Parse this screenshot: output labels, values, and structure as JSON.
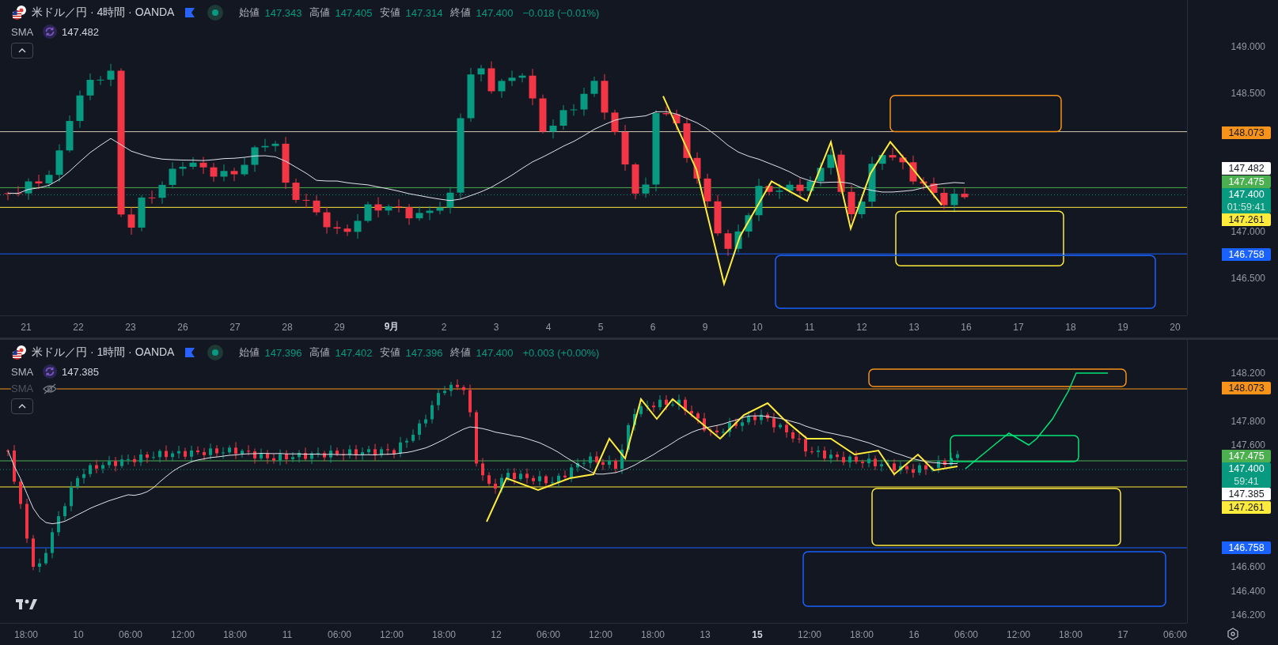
{
  "panes": [
    {
      "title": "米ドル／円 · 4時間 · OANDA",
      "ohlc": [
        {
          "label": "始値",
          "value": "147.343"
        },
        {
          "label": "高値",
          "value": "147.405"
        },
        {
          "label": "安値",
          "value": "147.314"
        },
        {
          "label": "終値",
          "value": "147.400"
        }
      ],
      "change": "−0.018 (−0.01%)",
      "indicators": [
        {
          "name": "SMA",
          "value": "147.482",
          "visible": true
        }
      ],
      "price_ticks": [
        "149.000",
        "148.500",
        "147.000",
        "146.500"
      ],
      "price_markers": [
        {
          "value": "148.073",
          "color": "#f7931a"
        },
        {
          "value": "147.482",
          "color": "#ffffff"
        },
        {
          "value": "147.475",
          "color": "#4caf50"
        },
        {
          "value": "147.400",
          "countdown": "01:59:41",
          "color": "#089981"
        },
        {
          "value": "147.261",
          "color": "#ffeb3b"
        },
        {
          "value": "146.758",
          "color": "#1962ff"
        }
      ],
      "time_labels": [
        {
          "label": "21",
          "major": false
        },
        {
          "label": "22",
          "major": false
        },
        {
          "label": "23",
          "major": false
        },
        {
          "label": "26",
          "major": false
        },
        {
          "label": "27",
          "major": false
        },
        {
          "label": "28",
          "major": false
        },
        {
          "label": "29",
          "major": false
        },
        {
          "label": "9月",
          "major": true
        },
        {
          "label": "2",
          "major": false
        },
        {
          "label": "3",
          "major": false
        },
        {
          "label": "4",
          "major": false
        },
        {
          "label": "5",
          "major": false
        },
        {
          "label": "6",
          "major": false
        },
        {
          "label": "9",
          "major": false
        },
        {
          "label": "10",
          "major": false
        },
        {
          "label": "11",
          "major": false
        },
        {
          "label": "12",
          "major": false
        },
        {
          "label": "13",
          "major": false
        },
        {
          "label": "16",
          "major": false
        },
        {
          "label": "17",
          "major": false
        },
        {
          "label": "18",
          "major": false
        },
        {
          "label": "19",
          "major": false
        },
        {
          "label": "20",
          "major": false
        }
      ]
    },
    {
      "title": "米ドル／円 · 1時間 · OANDA",
      "ohlc": [
        {
          "label": "始値",
          "value": "147.396"
        },
        {
          "label": "高値",
          "value": "147.402"
        },
        {
          "label": "安値",
          "value": "147.396"
        },
        {
          "label": "終値",
          "value": "147.400"
        }
      ],
      "change": "+0.003 (+0.00%)",
      "indicators": [
        {
          "name": "SMA",
          "value": "147.385",
          "visible": true
        },
        {
          "name": "SMA",
          "visible": false
        }
      ],
      "price_ticks": [
        "148.200",
        "147.800",
        "147.600",
        "146.600",
        "146.400",
        "146.200"
      ],
      "price_markers": [
        {
          "value": "148.073",
          "color": "#f7931a"
        },
        {
          "value": "147.475",
          "color": "#4caf50"
        },
        {
          "value": "147.400",
          "countdown": "59:41",
          "color": "#089981"
        },
        {
          "value": "147.385",
          "color": "#ffffff"
        },
        {
          "value": "147.261",
          "color": "#ffeb3b"
        },
        {
          "value": "146.758",
          "color": "#1962ff"
        }
      ],
      "time_labels": [
        {
          "label": "18:00",
          "major": false
        },
        {
          "label": "10",
          "major": false
        },
        {
          "label": "06:00",
          "major": false
        },
        {
          "label": "12:00",
          "major": false
        },
        {
          "label": "18:00",
          "major": false
        },
        {
          "label": "11",
          "major": false
        },
        {
          "label": "06:00",
          "major": false
        },
        {
          "label": "12:00",
          "major": false
        },
        {
          "label": "18:00",
          "major": false
        },
        {
          "label": "12",
          "major": false
        },
        {
          "label": "06:00",
          "major": false
        },
        {
          "label": "12:00",
          "major": false
        },
        {
          "label": "18:00",
          "major": false
        },
        {
          "label": "13",
          "major": false
        },
        {
          "label": "15",
          "major": true
        },
        {
          "label": "12:00",
          "major": false
        },
        {
          "label": "18:00",
          "major": false
        },
        {
          "label": "16",
          "major": false
        },
        {
          "label": "06:00",
          "major": false
        },
        {
          "label": "12:00",
          "major": false
        },
        {
          "label": "18:00",
          "major": false
        },
        {
          "label": "17",
          "major": false
        },
        {
          "label": "06:00",
          "major": false
        }
      ]
    }
  ]
}
